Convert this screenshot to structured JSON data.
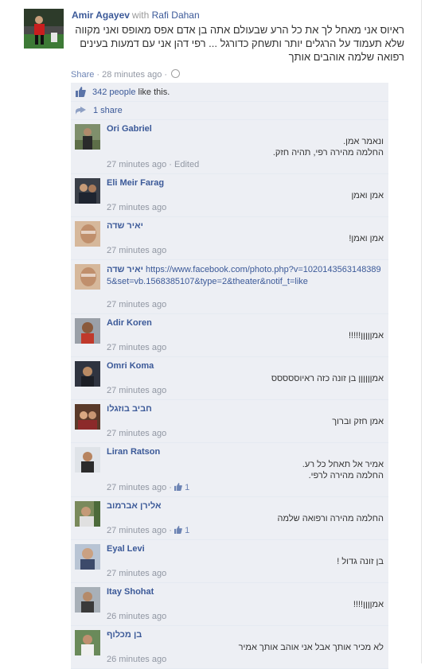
{
  "post": {
    "author": "Amir Agayev",
    "with_word": "with",
    "with_name": "Rafi Dahan",
    "text": "ראיוס אני מאחל לך את כל הרע שבעולם אתה בן אדם אפס מאופס ואני מקווה שלא תעמוד על הרגלים יותר ותשחק כדורגל ... רפי דהן אני עם דמעות בעינים רפואה שלמה אוהבים אותך"
  },
  "actions": {
    "share": "Share",
    "sep1": " · ",
    "time": "28 minutes ago",
    "sep2": " · "
  },
  "likes": {
    "link": "342 people",
    "rest": " like this."
  },
  "shares": {
    "label": "1 share"
  },
  "comments": [
    {
      "name": "Ori Gabriel",
      "body": "ונאמר אמן.\nהחלמה מהירה רפי, תהיה חזק.",
      "time": "27 minutes ago",
      "edited": "Edited"
    },
    {
      "name": "Eli Meir Farag",
      "body": "אמן ואמן",
      "time": "27 minutes ago"
    },
    {
      "name": "יאיר שדה",
      "body": "אמן ואמן!",
      "time": "27 minutes ago"
    },
    {
      "name": "יאיר שדה",
      "url": "https://www.facebook.com/photo.php?v=10201435631483895&set=vb.1568385107&type=2&theater&notif_t=like",
      "time": "27 minutes ago"
    },
    {
      "name": "Adir Koren",
      "body": "אמןןןןן!!!!!",
      "time": "27 minutes ago"
    },
    {
      "name": "Omri Koma",
      "body": "אמןןןןןן בן זונה כזה ראיוססססס",
      "time": "27 minutes ago"
    },
    {
      "name": "חביב בוזגלו",
      "body": "אמן חזק וברוך",
      "time": "27 minutes ago"
    },
    {
      "name": "Liran Ratson",
      "body": "אמיר אל תאחל כל רע.\nהחלמה מהירה לרפי.",
      "time": "27 minutes ago",
      "likes": "1"
    },
    {
      "name": "אלירן אברמוב",
      "body": "החלמה מהירה ורפואה שלמה",
      "time": "27 minutes ago",
      "likes": "1"
    },
    {
      "name": "Eyal Levi",
      "body": "בן זונה גדול !",
      "time": "27 minutes ago"
    },
    {
      "name": "Itay Shohat",
      "body": "אמןןןן!!!!",
      "time": "26 minutes ago"
    },
    {
      "name": "בן מכלוף",
      "body": "לא מכיר אותך אבל אני אוהב אותך אמיר",
      "time": "26 minutes ago"
    }
  ],
  "colors": {
    "link": "#3b5998",
    "ufi_bg": "#edeff4",
    "meta": "#9197a3"
  }
}
